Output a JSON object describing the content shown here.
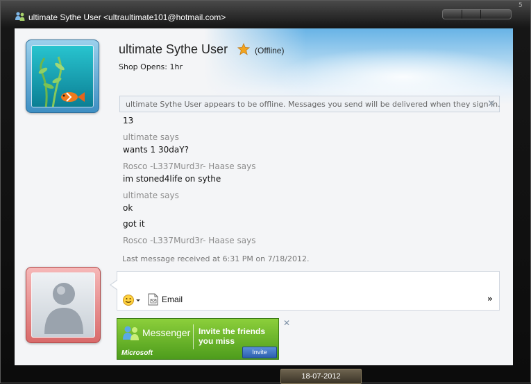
{
  "window": {
    "title": "ultimate Sythe User <ultraultimate101@hotmail.com>",
    "corner_badge": "5"
  },
  "contact": {
    "name": "ultimate Sythe User",
    "status": "(Offline)",
    "personal_message": "Shop Opens: 1hr"
  },
  "offline_banner": {
    "text": "ultimate Sythe User appears to be offline. Messages you send will be delivered when they sign in.",
    "close": "✕"
  },
  "conversation": {
    "lines": [
      {
        "type": "msg",
        "text": "13"
      },
      {
        "type": "sender",
        "text": "ultimate says"
      },
      {
        "type": "msg",
        "text": "wants 1 30daY?"
      },
      {
        "type": "sender",
        "text": "Rosco -L337Murd3r- Haase says"
      },
      {
        "type": "msg",
        "text": "im stoned4life on sythe"
      },
      {
        "type": "sender",
        "text": "ultimate says"
      },
      {
        "type": "msg",
        "text": "ok"
      },
      {
        "type": "msg",
        "text": "got it"
      },
      {
        "type": "sender",
        "text": "Rosco -L337Murd3r- Haase says"
      }
    ]
  },
  "last_message": "Last message received at 6:31 PM on 7/18/2012.",
  "compose": {
    "email_label": "Email",
    "more": "»"
  },
  "ad": {
    "brand": "Messenger",
    "headline": "Invite the friends you miss",
    "footer": "Microsoft",
    "invite_label": "Invite",
    "close": "✕"
  },
  "datebar": "18-07-2012",
  "colors": {
    "accent_star": "#f2a41e",
    "ad_green": "#6cb42b"
  }
}
